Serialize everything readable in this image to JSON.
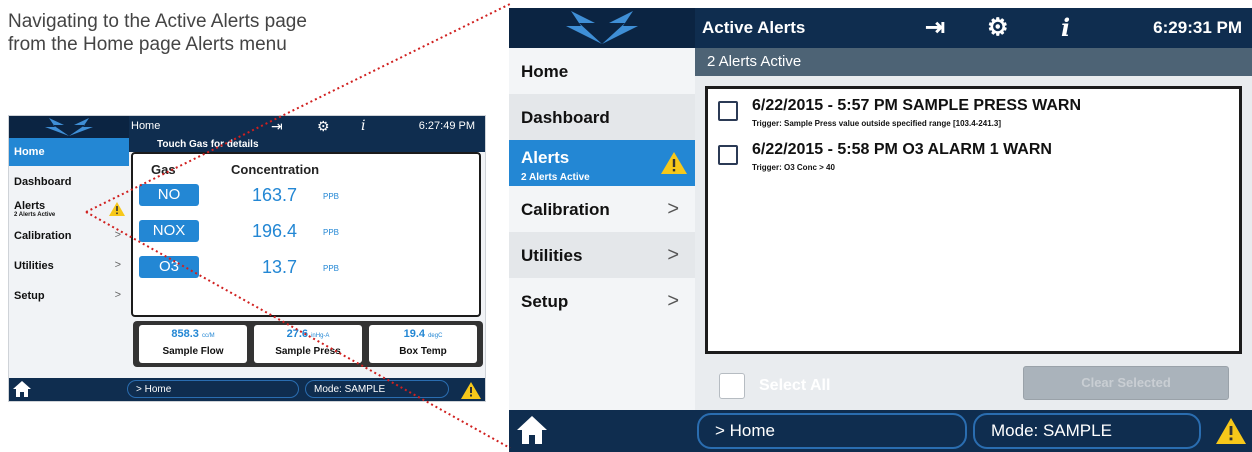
{
  "caption": {
    "line1": "Navigating to the Active Alerts page",
    "line2": "from the Home page Alerts menu"
  },
  "colors": {
    "header_bg": "#0f2d4f",
    "accent_blue": "#2387d4",
    "subheader_bg": "#4d6375",
    "warning_yellow": "#f7c81a",
    "leader_line": "#d0201f"
  },
  "home_screen": {
    "header": {
      "title": "Home",
      "time": "6:27:49 PM",
      "icons": [
        "exit-icon",
        "gear-icon",
        "info-icon"
      ]
    },
    "sidebar": [
      {
        "label": "Home",
        "active": true
      },
      {
        "label": "Dashboard"
      },
      {
        "label": "Alerts",
        "sublabel": "2 Alerts Active",
        "icon": "warning-icon"
      },
      {
        "label": "Calibration",
        "chevron": ">"
      },
      {
        "label": "Utilities",
        "chevron": ">"
      },
      {
        "label": "Setup",
        "chevron": ">"
      }
    ],
    "gas_header": "Touch Gas for details",
    "col_gas": "Gas",
    "col_concentration": "Concentration",
    "gases": [
      {
        "name": "NO",
        "value": "163.7",
        "unit": "PPB"
      },
      {
        "name": "NOX",
        "value": "196.4",
        "unit": "PPB"
      },
      {
        "name": "O3",
        "value": "13.7",
        "unit": "PPB"
      }
    ],
    "meters": [
      {
        "value": "858.3",
        "unit": "cc/M",
        "label": "Sample Flow"
      },
      {
        "value": "27.6",
        "unit": "inHg-A",
        "label": "Sample Press"
      },
      {
        "value": "19.4",
        "unit": "degC",
        "label": "Box Temp"
      }
    ],
    "footer": {
      "path": "> Home",
      "mode": "Mode: SAMPLE"
    }
  },
  "alerts_screen": {
    "header": {
      "title": "Active Alerts",
      "time": "6:29:31 PM",
      "icons": [
        "exit-icon",
        "gear-icon",
        "info-icon"
      ]
    },
    "sidebar": [
      {
        "label": "Home"
      },
      {
        "label": "Dashboard"
      },
      {
        "label": "Alerts",
        "sublabel": "2 Alerts Active",
        "active": true,
        "icon": "warning-icon"
      },
      {
        "label": "Calibration",
        "chevron": ">"
      },
      {
        "label": "Utilities",
        "chevron": ">"
      },
      {
        "label": "Setup",
        "chevron": ">"
      }
    ],
    "subheader": "2 Alerts Active",
    "alerts": [
      {
        "title": "6/22/2015 - 5:57 PM SAMPLE PRESS WARN",
        "trigger": "Trigger: Sample Press value outside specified range [103.4-241.3]",
        "checked": false
      },
      {
        "title": "6/22/2015 - 5:58 PM O3 ALARM 1 WARN",
        "trigger": "Trigger: O3 Conc > 40",
        "checked": false
      }
    ],
    "select_all": "Select All",
    "clear_selected": "Clear Selected",
    "footer": {
      "path": "> Home",
      "mode": "Mode: SAMPLE"
    }
  }
}
